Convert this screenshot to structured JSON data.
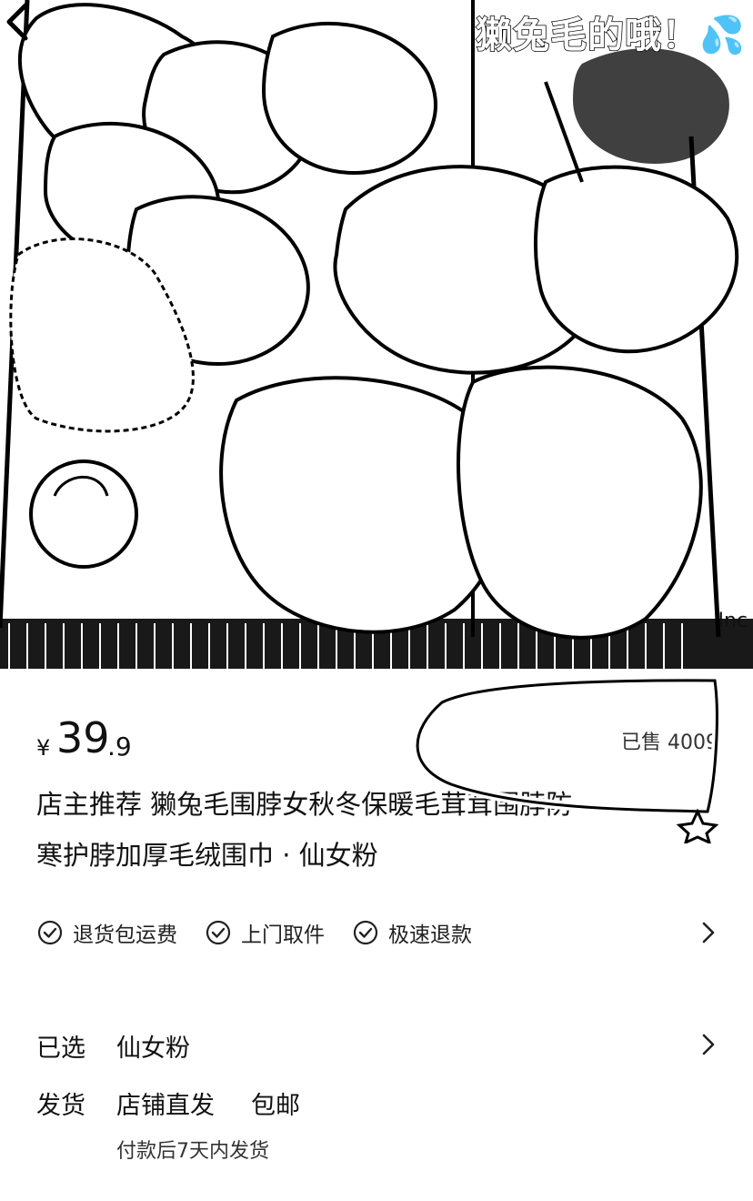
{
  "hero": {
    "overlay_text": "獭兔毛的哦！💦",
    "corner_watermark": "Inc"
  },
  "icons": {
    "back": "chevron-left-icon",
    "check": "check-circle-icon",
    "chevron": "chevron-right-icon",
    "star": "star-icon"
  },
  "price": {
    "currency": "¥",
    "integer": "39",
    "decimal": ".9",
    "sold": "已售 4009"
  },
  "title": {
    "line1": "店主推荐 獭兔毛围脖女秋冬保暖毛茸茸围脖防",
    "line2": "寒护脖加厚毛绒围巾 · 仙女粉"
  },
  "services": [
    {
      "label": "退货包运费"
    },
    {
      "label": "上门取件"
    },
    {
      "label": "极速退款"
    }
  ],
  "spec": {
    "selected_label": "已选",
    "selected_value": "仙女粉",
    "ship_label": "发货",
    "ship_value": "店铺直发",
    "ship_extra": "包邮",
    "ship_note": "付款后7天内发货"
  }
}
